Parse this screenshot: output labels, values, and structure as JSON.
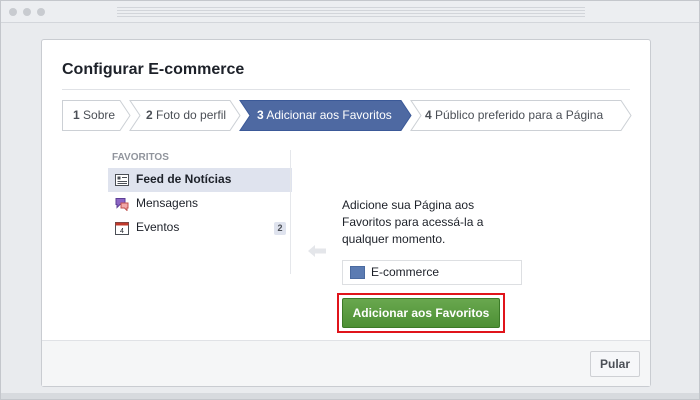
{
  "dialog": {
    "title": "Configurar E-commerce",
    "steps": [
      {
        "num": "1",
        "label": "Sobre"
      },
      {
        "num": "2",
        "label": "Foto do perfil"
      },
      {
        "num": "3",
        "label": "Adicionar aos Favoritos"
      },
      {
        "num": "4",
        "label": "Público preferido para a Página"
      }
    ],
    "active_step": 3
  },
  "sidebar": {
    "heading": "FAVORITOS",
    "items": [
      {
        "label": "Feed de Notícias",
        "icon": "news-feed-icon",
        "selected": true
      },
      {
        "label": "Mensagens",
        "icon": "messages-icon"
      },
      {
        "label": "Eventos",
        "icon": "calendar-icon",
        "icon_text": "4",
        "badge": "2"
      }
    ]
  },
  "main": {
    "description": "Adicione sua Página aos Favoritos para acessá-la a qualquer momento.",
    "favorite_item": "E-commerce",
    "add_button": "Adicionar aos Favoritos"
  },
  "footer": {
    "skip_button": "Pular"
  },
  "colors": {
    "active_step": "#4e69a2",
    "add_button": "#5a9b3f",
    "highlight_border": "#e0141b"
  }
}
